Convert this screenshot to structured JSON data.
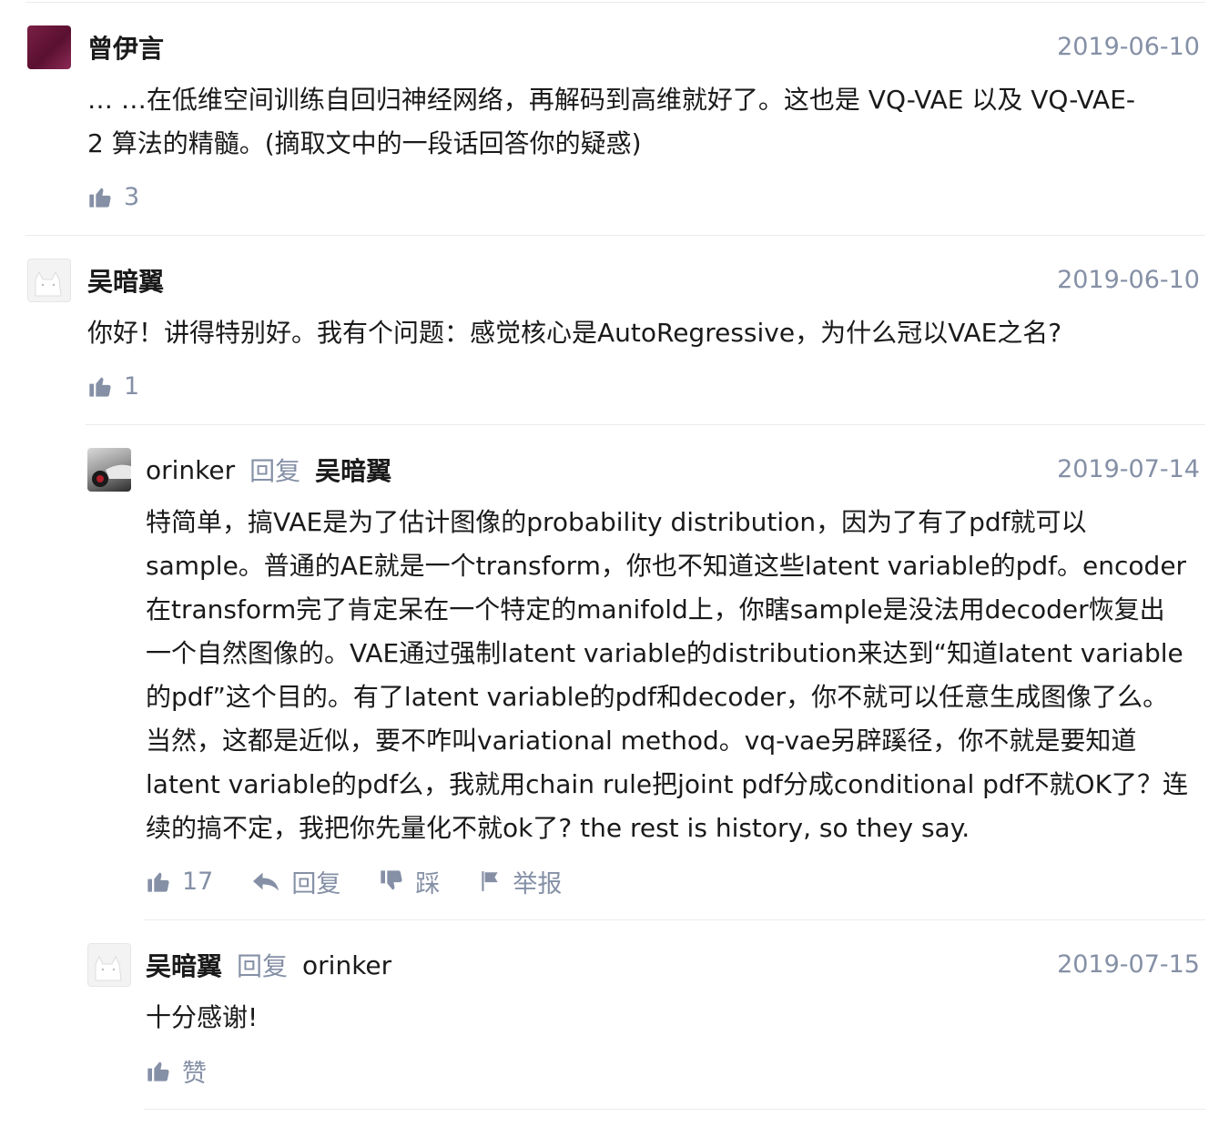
{
  "comments": [
    {
      "author": "曾伊言",
      "date": "2019-06-10",
      "avatar_icon": "avatar-image",
      "content": [
        "… …在低维空间训练自回归神经网络，再解码到高维就好了。这也是 VQ-VAE 以及 VQ-VAE-",
        "2 算法的精髓。(摘取文中的一段话回答你的疑惑)"
      ],
      "likes": "3"
    },
    {
      "author": "吴暗翼",
      "date": "2019-06-10",
      "avatar_icon": "cat-avatar-image",
      "content": [
        "你好！讲得特别好。我有个问题：感觉核心是AutoRegressive，为什么冠以VAE之名?"
      ],
      "likes": "1"
    },
    {
      "author": "orinker",
      "reply_word": "回复",
      "reply_to": "吴暗翼",
      "date": "2019-07-14",
      "avatar_icon": "car-avatar-image",
      "content": [
        "特简单，搞VAE是为了估计图像的probability distribution，因为了有了pdf就可以",
        "sample。普通的AE就是一个transform，你也不知道这些latent variable的pdf。encoder",
        "在transform完了肯定呆在一个特定的manifold上，你瞎sample是没法用decoder恢复出",
        "一个自然图像的。VAE通过强制latent variable的distribution来达到“知道latent variable",
        "的pdf”这个目的。有了latent variable的pdf和decoder，你不就可以任意生成图像了么。",
        "当然，这都是近似，要不咋叫variational method。vq-vae另辟蹊径，你不就是要知道",
        "latent variable的pdf么，我就用chain rule把joint pdf分成conditional pdf不就OK了？连",
        "续的搞不定，我把你先量化不就ok了? the rest is history, so they say."
      ],
      "likes": "17",
      "actions": {
        "reply": "回复",
        "dislike": "踩",
        "report": "举报"
      }
    },
    {
      "author": "吴暗翼",
      "reply_word": "回复",
      "reply_to": "orinker",
      "date": "2019-07-15",
      "avatar_icon": "cat-avatar-image",
      "content": [
        "十分感谢!"
      ],
      "likes": "赞"
    }
  ],
  "colors": {
    "meta": "#8590a6",
    "text": "#1a1a1a",
    "divider": "#ececec"
  }
}
